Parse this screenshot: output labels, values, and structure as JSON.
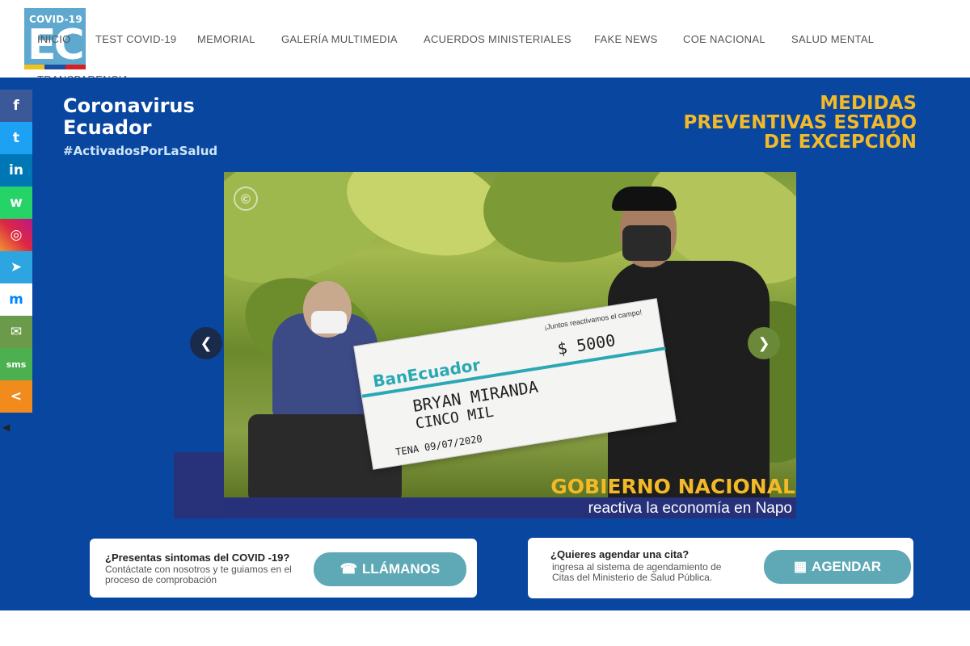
{
  "logo": {
    "small_text": "COVID-19",
    "big_text": "EC",
    "stripe_colors": [
      "#f2c21b",
      "#1b4fa0",
      "#d62027"
    ]
  },
  "nav": {
    "items": [
      {
        "label": "Inicio"
      },
      {
        "label": "Test COVID-19"
      },
      {
        "label": "Memorial"
      },
      {
        "label": "Galería Multimedia"
      },
      {
        "label": "Acuerdos Ministeriales"
      },
      {
        "label": "Fake News"
      },
      {
        "label": "COE Nacional"
      },
      {
        "label": "Salud Mental"
      },
      {
        "label": "Transparencia"
      }
    ]
  },
  "banner": {
    "brand_line1": "Coronavirus",
    "brand_line2": "Ecuador",
    "hashtag": "#ActivadosPorLaSalud",
    "medidas_line1": "MEDIDAS",
    "medidas_line2": "PREVENTIVAS ESTADO",
    "medidas_line3": "DE EXCEPCIÓN"
  },
  "slide": {
    "caption_title": "GOBIERNO NACIONAL",
    "caption_subtitle": "reactiva la economía en Napo",
    "check_text": "¡Juntos reactivamos el campo!",
    "check_amount": "$ 5000",
    "check_name": "BRYAN MIRANDA",
    "check_words": "CINCO MIL",
    "check_brand": "BanEcuador",
    "check_place_date": "TENA 09/07/2020"
  },
  "cta_left": {
    "question": "¿Presentas sintomas del COVID -19?",
    "description": "Contáctate con nosotros y te guiamos en el proceso de comprobación",
    "button_label": "LLÁMANOS",
    "button_icon": "phone-icon"
  },
  "cta_right": {
    "question": "¿Quieres agendar una cita?",
    "description": "ingresa al sistema de agendamiento de Citas del Ministerio de Salud Pública.",
    "button_label": "AGENDAR",
    "button_icon": "calendar-icon"
  },
  "share_bar": [
    {
      "name": "facebook",
      "glyph": "f",
      "color": "#3b5998"
    },
    {
      "name": "twitter",
      "glyph": "t",
      "color": "#1da1f2"
    },
    {
      "name": "linkedin",
      "glyph": "in",
      "color": "#0077b5"
    },
    {
      "name": "whatsapp",
      "glyph": "w",
      "color": "#25d366"
    },
    {
      "name": "instagram",
      "glyph": "◎",
      "color": "#c13584"
    },
    {
      "name": "telegram",
      "glyph": "➤",
      "color": "#2ca5e0"
    },
    {
      "name": "messenger",
      "glyph": "m",
      "color": "#ffffff"
    },
    {
      "name": "email",
      "glyph": "✉",
      "color": "#6a9a4a"
    },
    {
      "name": "sms",
      "glyph": "sms",
      "color": "#4caf50"
    },
    {
      "name": "share",
      "glyph": "<",
      "color": "#f28b1e"
    }
  ]
}
